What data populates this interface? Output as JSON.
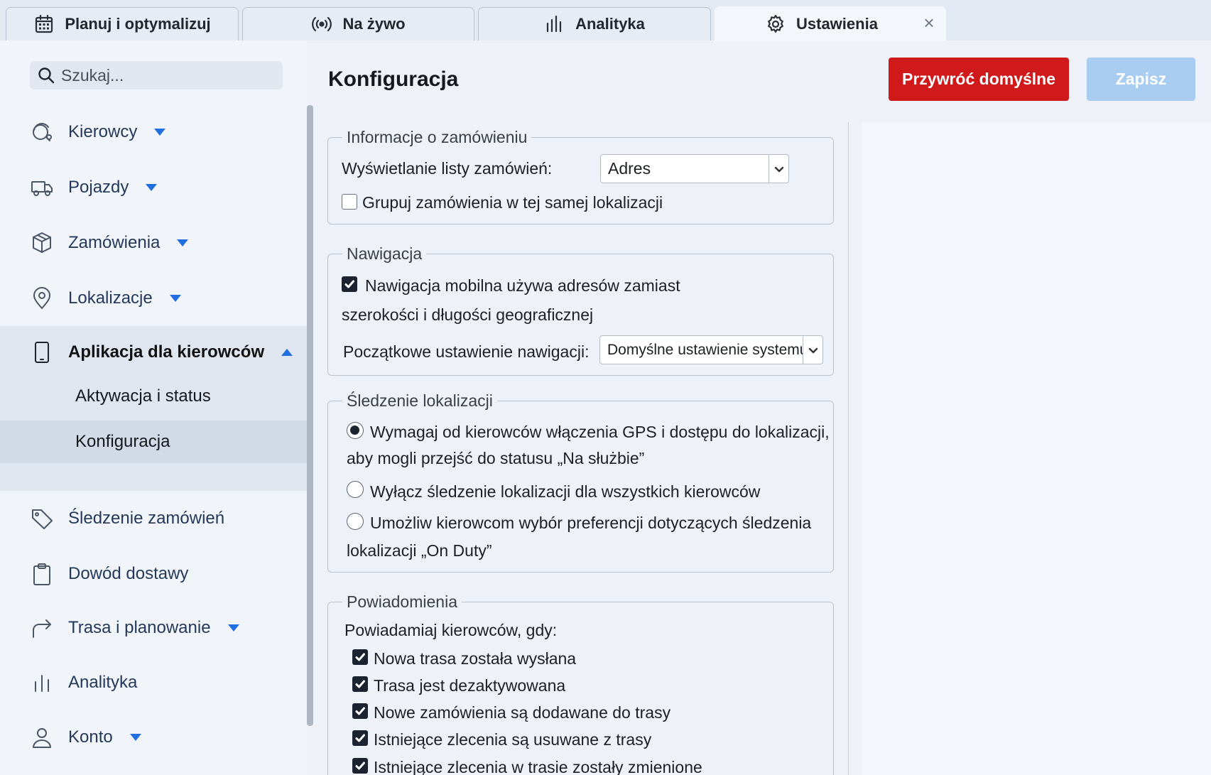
{
  "tabs": [
    {
      "label": "Planuj i optymalizuj",
      "icon": "calendar-icon"
    },
    {
      "label": "Na żywo",
      "icon": "live-broadcast-icon"
    },
    {
      "label": "Analityka",
      "icon": "bar-chart-icon"
    },
    {
      "label": "Ustawienia",
      "icon": "gear-icon",
      "active": true,
      "close_symbol": "×"
    }
  ],
  "search": {
    "placeholder": "Szukaj..."
  },
  "sidebar": {
    "items": [
      {
        "label": "Kierowcy",
        "icon": "drivers-icon",
        "caret": "down"
      },
      {
        "label": "Pojazdy",
        "icon": "truck-icon",
        "caret": "down"
      },
      {
        "label": "Zamówienia",
        "icon": "package-icon",
        "caret": "down"
      },
      {
        "label": "Lokalizacje",
        "icon": "location-pin-icon",
        "caret": "down"
      },
      {
        "label": "Aplikacja dla kierowców",
        "icon": "smartphone-icon",
        "caret": "up",
        "expanded": true
      },
      {
        "label": "Śledzenie zamówień",
        "icon": "tag-icon"
      },
      {
        "label": "Dowód dostawy",
        "icon": "clipboard-icon"
      },
      {
        "label": "Trasa i planowanie",
        "icon": "route-arrow-icon",
        "caret": "down"
      },
      {
        "label": "Analityka",
        "icon": "bar-chart-icon"
      },
      {
        "label": "Konto",
        "icon": "user-icon",
        "caret": "down"
      }
    ],
    "subitems": [
      {
        "label": "Aktywacja i status"
      },
      {
        "label": "Konfiguracja",
        "selected": true
      }
    ]
  },
  "main": {
    "title": "Konfiguracja",
    "reset_label": "Przywróć domyślne",
    "save_label": "Zapisz"
  },
  "order_info": {
    "legend": "Informacje o zamówieniu",
    "list_display_label": "Wyświetlanie listy zamówień:",
    "list_display_value": "Adres",
    "group_label": "Grupuj zamówienia w tej samej lokalizacji",
    "group_checked": false
  },
  "navigation": {
    "legend": "Nawigacja",
    "mobile_nav_line1": "Nawigacja mobilna używa adresów zamiast",
    "mobile_nav_line2": "szerokości i długości geograficznej",
    "mobile_nav_checked": true,
    "initial_label": "Początkowe ustawienie nawigacji:",
    "initial_value": "Domyślne ustawienie systemu"
  },
  "tracking": {
    "legend": "Śledzenie lokalizacji",
    "option1_line1": "Wymagaj od kierowców włączenia GPS i dostępu do lokalizacji,",
    "option1_line2": "aby mogli przejść do statusu „Na służbie”",
    "option2": "Wyłącz śledzenie lokalizacji dla wszystkich kierowców",
    "option3_line1": "Umożliw kierowcom wybór preferencji dotyczących śledzenia",
    "option3_line2": "lokalizacji „On Duty”",
    "selected_option": 1
  },
  "notifications": {
    "legend": "Powiadomienia",
    "intro": "Powiadamiaj kierowców, gdy:",
    "items": [
      {
        "label": "Nowa trasa została wysłana",
        "checked": true
      },
      {
        "label": "Trasa jest dezaktywowana",
        "checked": true
      },
      {
        "label": "Nowe zamówienia są dodawane do trasy",
        "checked": true
      },
      {
        "label": "Istniejące zlecenia są usuwane z trasy",
        "checked": true
      },
      {
        "label": "Istniejące zlecenia w trasie zostały zmienione",
        "checked": true
      }
    ]
  },
  "colors": {
    "danger": "#d0191a",
    "primary_disabled": "#a9cdf0",
    "accent": "#1f6fe0"
  }
}
